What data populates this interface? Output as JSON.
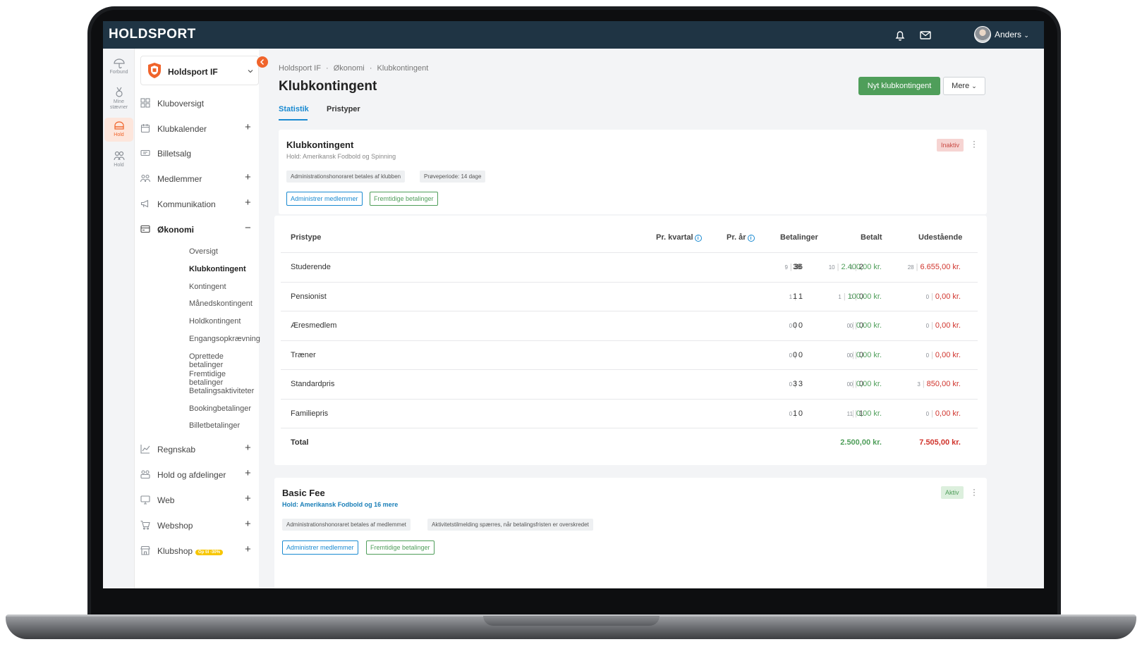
{
  "app": {
    "logo": "HOLDSPORT",
    "user": "Anders"
  },
  "rail": [
    {
      "label": "Forbund",
      "icon": "umbrella-icon"
    },
    {
      "label": "Mine stævner",
      "icon": "medal-icon"
    },
    {
      "label": "Hold",
      "icon": "team-icon",
      "active": true
    },
    {
      "label": "Hold",
      "icon": "group-icon"
    }
  ],
  "club": {
    "name": "Holdsport IF"
  },
  "nav": {
    "kluboversigt": "Kluboversigt",
    "klubkalender": "Klubkalender",
    "billetsalg": "Billetsalg",
    "medlemmer": "Medlemmer",
    "kommunikation": "Kommunikation",
    "okonomi": "Økonomi",
    "regnskab": "Regnskab",
    "hold": "Hold og afdelinger",
    "web": "Web",
    "webshop": "Webshop",
    "klubshop": "Klubshop",
    "klubshop_badge": "Op til -30%",
    "plus": "+",
    "minus": "−",
    "sub": [
      "Oversigt",
      "Klubkontingent",
      "Kontingent",
      "Månedskontingent",
      "Holdkontingent",
      "Engangsopkrævning",
      "Oprettede betalinger",
      "Fremtidige betalinger",
      "Betalingsaktiviteter",
      "Bookingbetalinger",
      "Billetbetalinger"
    ]
  },
  "breadcrumb": {
    "a": "Holdsport IF",
    "b": "Økonomi",
    "c": "Klubkontingent",
    "sep": "·"
  },
  "page": {
    "title": "Klubkontingent",
    "new_button": "Nyt klubkontingent",
    "more_button": "Mere"
  },
  "tabs": {
    "statistik": "Statistik",
    "pristyper": "Pristyper"
  },
  "card1": {
    "title": "Klubkontingent",
    "hold": "Hold: Amerikansk Fodbold og Spinning",
    "status": "Inaktiv",
    "chip1": "Administrationshonoraret betales af klubben",
    "chip2": "Prøveperiode: 14 dage",
    "btn1": "Administrer medlemmer",
    "btn2": "Fremtidige betalinger"
  },
  "table": {
    "headers": {
      "pristype": "Pristype",
      "kvartal": "Pr. kvartal",
      "aar": "Pr. år",
      "betalinger": "Betalinger",
      "betalt": "Betalt",
      "udestaaende": "Udestående"
    },
    "rows": [
      {
        "name": "Studerende",
        "kv_s": "9",
        "kv": "36",
        "ar_s": "1",
        "ar": "2",
        "bet": "38",
        "bt_s": "10",
        "bt": "2.400,00 kr.",
        "ud_s": "28",
        "ud": "6.655,00 kr."
      },
      {
        "name": "Pensionist",
        "kv_s": "1",
        "kv": "1",
        "ar_s": "0",
        "ar": "0",
        "bet": "1",
        "bt_s": "1",
        "bt": "100,00 kr.",
        "ud_s": "0",
        "ud": "0,00 kr."
      },
      {
        "name": "Æresmedlem",
        "kv_s": "0",
        "kv": "0",
        "ar_s": "0",
        "ar": "0",
        "bet": "0",
        "bt_s": "0",
        "bt": "0,00 kr.",
        "ud_s": "0",
        "ud": "0,00 kr."
      },
      {
        "name": "Træner",
        "kv_s": "0",
        "kv": "0",
        "ar_s": "0",
        "ar": "0",
        "bet": "0",
        "bt_s": "0",
        "bt": "0,00 kr.",
        "ud_s": "0",
        "ud": "0,00 kr."
      },
      {
        "name": "Standardpris",
        "kv_s": "0",
        "kv": "3",
        "ar_s": "0",
        "ar": "0",
        "bet": "3",
        "bt_s": "0",
        "bt": "0,00 kr.",
        "ud_s": "3",
        "ud": "850,00 kr."
      },
      {
        "name": "Familiepris",
        "kv_s": "0",
        "kv": "0",
        "ar_s": "1",
        "ar": "1",
        "bet": "1",
        "bt_s": "1",
        "bt": "0,00 kr.",
        "ud_s": "0",
        "ud": "0,00 kr."
      }
    ],
    "total": {
      "label": "Total",
      "betalt": "2.500,00 kr.",
      "udestaaende": "7.505,00 kr."
    }
  },
  "card2": {
    "title": "Basic Fee",
    "hold": "Hold: Amerikansk Fodbold og 16 mere",
    "status": "Aktiv",
    "chip1": "Administrationshonoraret betales af medlemmet",
    "chip2": "Aktivitetstilmelding spærres, når betalingsfristen er overskredet",
    "btn1": "Administrer medlemmer",
    "btn2": "Fremtidige betalinger"
  },
  "colors": {
    "topbar": "#1f3444",
    "accent": "#f0642b",
    "blue": "#1a8ad1",
    "green": "#4f9e5a",
    "red": "#d0342c"
  }
}
